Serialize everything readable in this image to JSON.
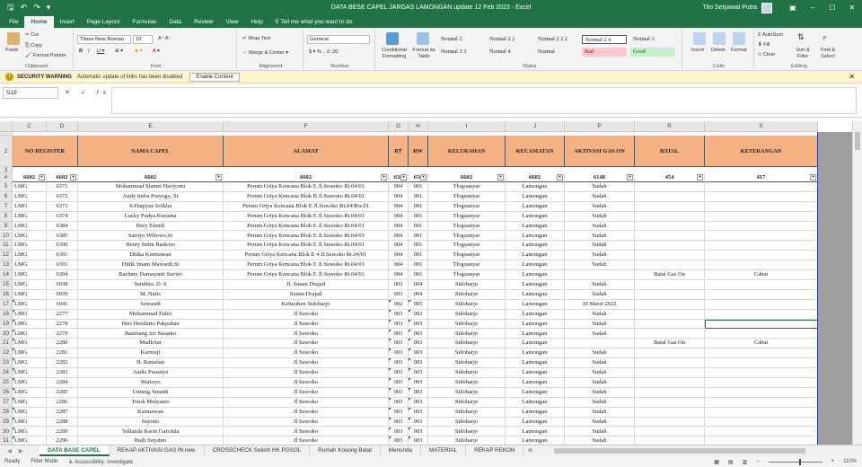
{
  "window": {
    "title": "DATA BESE CAPEL JARGAS LAMONGAN update 12 Feb 2023  -  Excel",
    "user": "Tito Setyawal Putra"
  },
  "tabs": [
    "File",
    "Home",
    "Insert",
    "Page Layout",
    "Formulas",
    "Data",
    "Review",
    "View",
    "Help"
  ],
  "active_tab": "Home",
  "tellme": "Tell me what you want to do",
  "ribbon": {
    "clipboard": {
      "label": "Clipboard",
      "paste": "Paste",
      "cut": "Cut",
      "copy": "Copy",
      "format_painter": "Format Painter"
    },
    "font": {
      "label": "Font",
      "family": "Times New Roman",
      "size": "10"
    },
    "alignment": {
      "label": "Alignment",
      "wrap": "Wrap Text",
      "merge": "Merge & Center"
    },
    "number": {
      "label": "Number",
      "format": "General"
    },
    "styles": {
      "label": "Styles",
      "cond": "Conditional Formatting",
      "format_table": "Format as Table",
      "items": [
        "Normal 2",
        "Normal 2 2",
        "Normal 2 2 2",
        "Normal 2 4",
        "Normal 3",
        "Normal 3 3",
        "Normal 4",
        "Normal",
        "Bad",
        "Good"
      ]
    },
    "cells": {
      "label": "Cells",
      "insert": "Insert",
      "delete": "Delete",
      "format": "Format"
    },
    "editing": {
      "label": "Editing",
      "autosum": "AutoSum",
      "fill": "Fill",
      "clear": "Clear",
      "sort": "Sort & Filter",
      "find": "Find & Select"
    }
  },
  "security": {
    "title": "SECURITY WARNING",
    "message": "Automatic update of links has been disabled",
    "button": "Enable Content"
  },
  "formula_bar": {
    "name_box": "S19",
    "fx": "✕ ✓ fx"
  },
  "columns": [
    {
      "letter": "C",
      "w": 38
    },
    {
      "letter": "D",
      "w": 35
    },
    {
      "letter": "E",
      "w": 162
    },
    {
      "letter": "F",
      "w": 184
    },
    {
      "letter": "G",
      "w": 22
    },
    {
      "letter": "H",
      "w": 22
    },
    {
      "letter": "I",
      "w": 86
    },
    {
      "letter": "J",
      "w": 66
    },
    {
      "letter": "P",
      "w": 78
    },
    {
      "letter": "R",
      "w": 78
    },
    {
      "letter": "S",
      "w": 126
    }
  ],
  "headers": [
    "NO REGISTER",
    "",
    "NAMA CAPEL",
    "ALAMAT",
    "RT",
    "RW",
    "KELURAHAN",
    "KECAMATAN",
    "AKTIVASI GAS ON",
    "BATAL",
    "KETERANGAN"
  ],
  "filter_row": [
    "6602",
    "6602",
    "6602",
    "6602",
    "656",
    "656",
    "6602",
    "6602",
    "6148",
    "454",
    "417"
  ],
  "rows": [
    {
      "n": "5",
      "c": [
        "LMG",
        "6371",
        "Mohammad Slamet Hariyono",
        "Perum Griya Kencana Blok E Jl.Suwoko Rt.04/01",
        "004",
        "001",
        "Tlogoanyar",
        "Lamongan",
        "Sudah",
        "",
        ""
      ]
    },
    {
      "n": "6",
      "c": [
        "LMG",
        "6372",
        "Andy Indra Prayogo, St",
        "Perum Griya Kencana Blok B Jl.Suwoko Rt.04/01",
        "004",
        "001",
        "Tlogoanyar",
        "Lamongan",
        "Sudah",
        "",
        ""
      ]
    },
    {
      "n": "7",
      "c": [
        "LMG",
        "6373",
        "Ir.Daqiyus Sofkha",
        "Perum Griya Kencana Blok E Jl.Suwoko Rt.04/Rw.01",
        "004",
        "001",
        "Tlogoanyar",
        "Lamongan",
        "Sudah",
        "",
        ""
      ]
    },
    {
      "n": "8",
      "c": [
        "LMG",
        "6374",
        "Lucky Pudya Kusuma",
        "Perum Griya Kencana Blok E Jl.Suwoko Rt.04/01",
        "004",
        "001",
        "Tlogoanyar",
        "Lamongan",
        "Sudah",
        "",
        ""
      ]
    },
    {
      "n": "9",
      "c": [
        "LMG",
        "6384",
        "Hery Efendi",
        "Perum Griya Kencana Blok E Jl.Suwoko Rt.04/01",
        "004",
        "001",
        "Tlogoanyar",
        "Lamongan",
        "Sudah",
        "",
        ""
      ]
    },
    {
      "n": "10",
      "c": [
        "LMG",
        "6385",
        "Satriyo Wibowo,St",
        "Perum Griya Kencana Blok E Jl.Suwoko Rt.04/01",
        "004",
        "001",
        "Tlogoanyar",
        "Lamongan",
        "Sudah",
        "",
        ""
      ]
    },
    {
      "n": "11",
      "c": [
        "LMG",
        "6390",
        "Henry Indra Baskoro",
        "Perum Griya Kencana Blok E Jl.Suwoko Rt.04/01",
        "004",
        "001",
        "Tlogoanyar",
        "Lamongan",
        "Sudah",
        "",
        ""
      ]
    },
    {
      "n": "12",
      "c": [
        "LMG",
        "6391",
        "Dhika Kurniawan",
        "Perum Griya Kencana Blok E 4 Jl.Suwoko Rt.04/01",
        "004",
        "001",
        "Tlogoanyar",
        "Lamongan",
        "Sudah",
        "",
        ""
      ]
    },
    {
      "n": "13",
      "c": [
        "LMG",
        "6393",
        "Didik Imam Mawardi,St",
        "Perum Griya Kencana Blok E Jl.Suwoko Rt.04/01",
        "004",
        "001",
        "Tlogoanyar",
        "Lamongan",
        "Sudah",
        "",
        ""
      ]
    },
    {
      "n": "14",
      "c": [
        "LMG",
        "6394",
        "Rachmy Damayanti Savitri",
        "Perum Griya Kencana Blok E Jl.Suwoko Rt.04/01",
        "004",
        "001",
        "Tlogoanyar",
        "Lamongan",
        "",
        "Batal Gas On",
        "Cabut"
      ]
    },
    {
      "n": "15",
      "c": [
        "LMG",
        "6938",
        "Sanditia. D. S",
        "Jl. Sunan Drajad",
        "003",
        "004",
        "Sidoharjo",
        "Lamongan",
        "Sudah",
        "",
        ""
      ]
    },
    {
      "n": "16",
      "c": [
        "LMG",
        "6939",
        "M. Nafis",
        "Sunan Drajad",
        "003",
        "004",
        "Sidoharjo",
        "Lamongan",
        "Sudah",
        "",
        ""
      ]
    },
    {
      "n": "17",
      "c": [
        "LMG",
        "6941",
        "Suwandi",
        "Kelurahan Sidoharjo",
        "002",
        "005",
        "Sidoharjo",
        "Lamongan",
        "30 Maret 2022",
        "",
        ""
      ]
    },
    {
      "n": "18",
      "c": [
        "LMG",
        "2277",
        "Muhammad Zuhri",
        "Jl Suwoko",
        "003",
        "003",
        "Sidoharjo",
        "Lamongan",
        "Sudah",
        "",
        ""
      ]
    },
    {
      "n": "19",
      "c": [
        "LMG",
        "2278",
        "Heri Hendarto Pakpahan",
        "Jl Suwoko",
        "003",
        "003",
        "Sidoharjo",
        "Lamongan",
        "Sudah",
        "",
        ""
      ]
    },
    {
      "n": "20",
      "c": [
        "LMG",
        "2279",
        "Bambang Ari Susanto",
        "Jl Suwoko",
        "003",
        "003",
        "Sidoharjo",
        "Lamongan",
        "Sudah",
        "",
        ""
      ]
    },
    {
      "n": "21",
      "c": [
        "LMG",
        "2280",
        "Mudlofar",
        "Jl Suwoko",
        "003",
        "003",
        "Sidoharjo",
        "Lamongan",
        "",
        "Batal Gas On",
        "Cabut"
      ]
    },
    {
      "n": "22",
      "c": [
        "LMG",
        "2281",
        "Karmuji",
        "Jl Suwoko",
        "003",
        "003",
        "Sidoharjo",
        "Lamongan",
        "Sudah",
        "",
        ""
      ]
    },
    {
      "n": "23",
      "c": [
        "LMG",
        "2282",
        "H. Ramelan",
        "Jl Suwoko",
        "003",
        "003",
        "Sidoharjo",
        "Lamongan",
        "Sudah",
        "",
        ""
      ]
    },
    {
      "n": "24",
      "c": [
        "LMG",
        "2283",
        "Andis Prasetyo",
        "Jl Suwoko",
        "003",
        "003",
        "Sidoharjo",
        "Lamongan",
        "Sudah",
        "",
        ""
      ]
    },
    {
      "n": "25",
      "c": [
        "LMG",
        "2284",
        "Wartoyo",
        "Jl Suwoko",
        "003",
        "003",
        "Sidoharjo",
        "Lamongan",
        "Sudah",
        "",
        ""
      ]
    },
    {
      "n": "26",
      "c": [
        "LMG",
        "2285",
        "Untung Junaidi",
        "Jl Suwoko",
        "003",
        "003",
        "Sidoharjo",
        "Lamongan",
        "Sudah",
        "",
        ""
      ]
    },
    {
      "n": "27",
      "c": [
        "LMG",
        "2286",
        "Totok Mulyanto",
        "Jl Suwoko",
        "003",
        "003",
        "Sidoharjo",
        "Lamongan",
        "Sudah",
        "",
        ""
      ]
    },
    {
      "n": "28",
      "c": [
        "LMG",
        "2287",
        "Kasmawan",
        "Jl Suwoko",
        "003",
        "003",
        "Sidoharjo",
        "Lamongan",
        "Sudah",
        "",
        ""
      ]
    },
    {
      "n": "29",
      "c": [
        "LMG",
        "2288",
        "Suyono",
        "Jl Suwoko",
        "003",
        "003",
        "Sidoharjo",
        "Lamongan",
        "Sudah",
        "",
        ""
      ]
    },
    {
      "n": "30",
      "c": [
        "LMG",
        "2289",
        "Yollanda Karin Garcinia",
        "Jl Suwoko",
        "003",
        "003",
        "Sidoharjo",
        "Lamongan",
        "Sudah",
        "",
        ""
      ]
    },
    {
      "n": "31",
      "c": [
        "LMG",
        "2290",
        "Rudi Suyatno",
        "Jl Suwoko",
        "003",
        "003",
        "Sidoharjo",
        "Lamongan",
        "Sudah",
        "",
        ""
      ]
    }
  ],
  "sheet_tabs": [
    "DATA BASE CAPEL",
    "REKAP AKTIVASI GAS IN new",
    "CROSSCHECK Selisih HK PGSOL",
    "Rumah Kosong Batal",
    "Menunda",
    "MATERIAL",
    "REKAP REKON"
  ],
  "active_sheet": "DATA BASE CAPEL",
  "status": {
    "ready": "Ready",
    "filter": "Filter Mode",
    "accessibility": "Accessibility: Investigate",
    "zoom": "110%"
  },
  "colors": {
    "accent": "#217346",
    "header_fill": "#f4b183",
    "bad_fill": "#ffc7ce",
    "good_fill": "#c6efce",
    "warning_bar": "#fff4ce"
  },
  "icons": [
    "save-icon",
    "undo-icon",
    "redo-icon",
    "paste-icon",
    "cut-icon",
    "copy-icon",
    "format-painter-icon",
    "bold-icon",
    "italic-icon",
    "underline-icon",
    "wrap-text-icon",
    "merge-icon",
    "autosum-icon",
    "fill-icon",
    "clear-icon",
    "sort-filter-icon",
    "find-icon",
    "warning-icon",
    "close-icon"
  ]
}
